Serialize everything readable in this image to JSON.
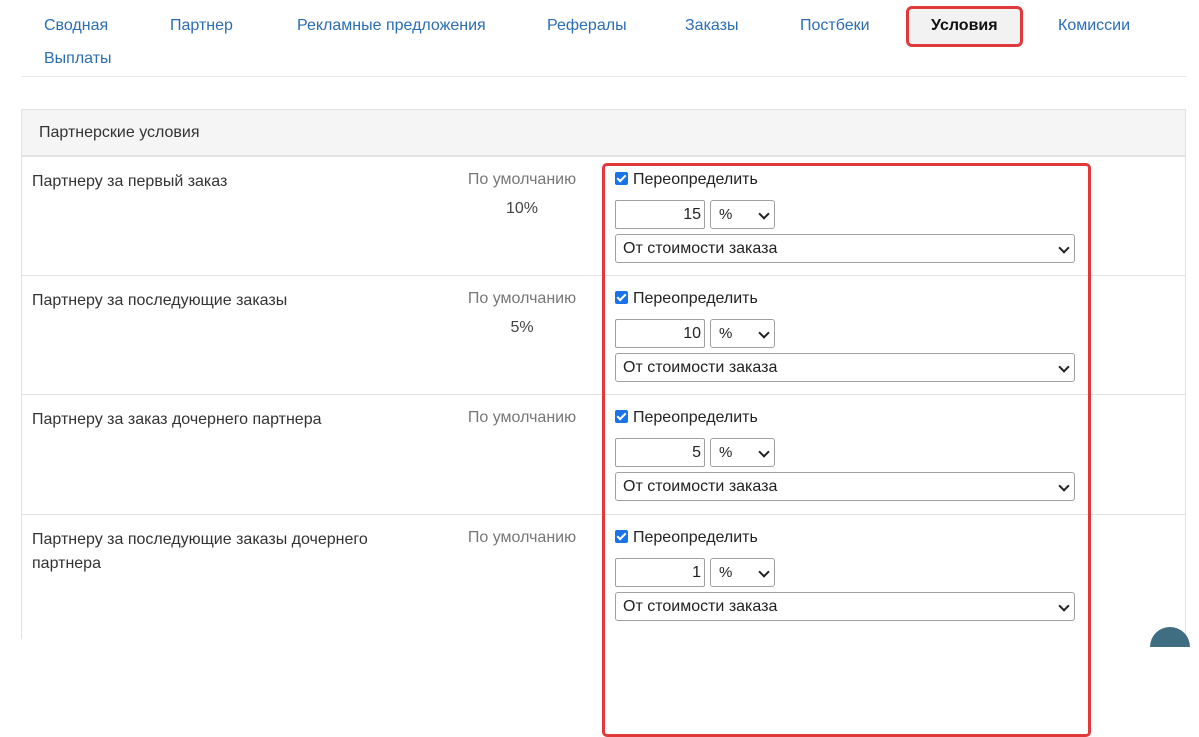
{
  "tabs": [
    {
      "label": "Сводная"
    },
    {
      "label": "Партнер"
    },
    {
      "label": "Рекламные предложения"
    },
    {
      "label": "Рефералы"
    },
    {
      "label": "Заказы"
    },
    {
      "label": "Постбеки"
    },
    {
      "label": "Условия",
      "active": true
    },
    {
      "label": "Комиссии"
    },
    {
      "label": "Выплаты"
    }
  ],
  "panel": {
    "title": "Партнерские условия",
    "default_label": "По умолчанию",
    "override_label": "Переопределить",
    "rows": [
      {
        "label": "Партнеру за первый заказ",
        "default_value": "10%",
        "override_checked": true,
        "value": "15",
        "unit": "%",
        "base": "От стоимости заказа"
      },
      {
        "label": "Партнеру за последующие заказы",
        "default_value": "5%",
        "override_checked": true,
        "value": "10",
        "unit": "%",
        "base": "От стоимости заказа"
      },
      {
        "label": "Партнеру за заказ дочернего партнера",
        "default_value": "",
        "override_checked": true,
        "value": "5",
        "unit": "%",
        "base": "От стоимости заказа"
      },
      {
        "label": "Партнеру за последующие заказы дочернего партнера",
        "default_value": "",
        "override_checked": true,
        "value": "1",
        "unit": "%",
        "base": "От стоимости заказа"
      }
    ]
  },
  "colors": {
    "accent": "#2a6db5",
    "highlight": "#e0393b",
    "checkbox": "#1a73e8"
  }
}
